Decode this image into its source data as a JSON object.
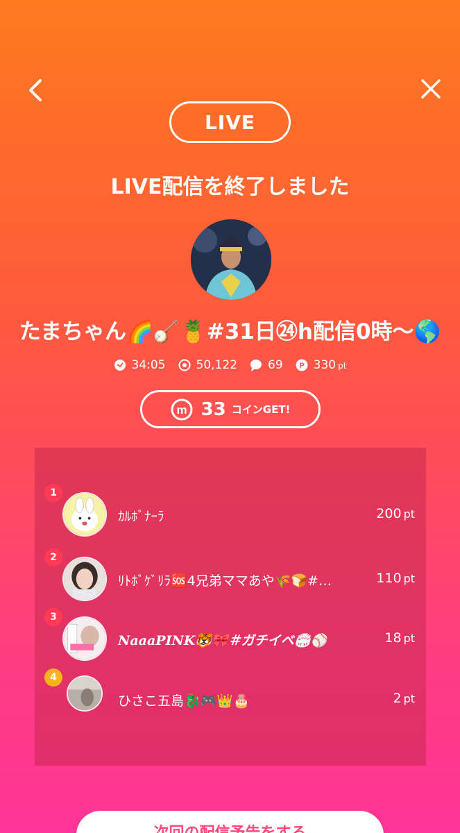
{
  "header": {
    "back_icon": "chevron-left-icon",
    "close_icon": "close-icon"
  },
  "live_label": "LIVE",
  "headline": "LIVE配信を終了しました",
  "streamer": {
    "name": "たまちゃん🌈🪕🍍#31日㉔h配信0時〜🌎"
  },
  "stats": {
    "duration": "34:05",
    "viewers": "50,122",
    "comments": "69",
    "points": "330",
    "points_unit": "pt"
  },
  "coins": {
    "count": "33",
    "label": "コインGET!"
  },
  "ranking": [
    {
      "rank": "1",
      "name": "ｶﾙﾎﾞﾅｰﾗ",
      "points": "200",
      "unit": "pt"
    },
    {
      "rank": "2",
      "name": "ﾘﾄﾎﾞｹﾞﾘﾗ🆘4兄弟ママあや🌾🍞#…",
      "points": "110",
      "unit": "pt"
    },
    {
      "rank": "3",
      "name": "𝑵𝒂𝒂𝒂𝑷𝑰𝑵𝑲🐯🎀＃ガチイベ🏟⚾",
      "points": "18",
      "unit": "pt"
    },
    {
      "rank": "4",
      "name": "ひさこ五島🐉🎮👑🎂",
      "points": "2",
      "unit": "pt"
    }
  ],
  "bottom_button": "次回の配信予告をする",
  "colors": {
    "gradient_top": "#ff7a1f",
    "gradient_bottom": "#ff3498",
    "accent_pink": "#ff4a7a",
    "gold": "#f7b21c"
  }
}
